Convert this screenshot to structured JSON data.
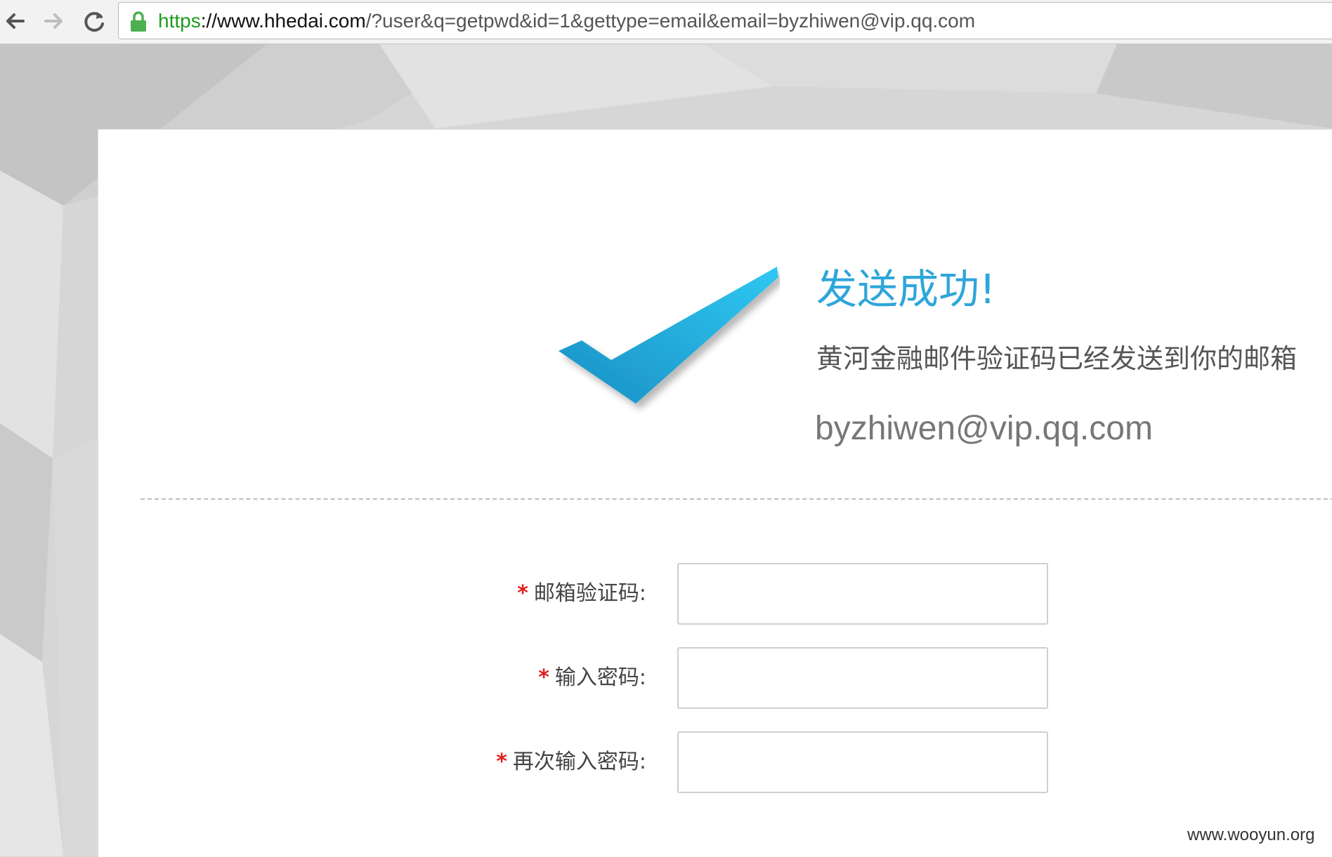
{
  "browser": {
    "url_scheme": "https",
    "url_host": "://www.hhedai.com",
    "url_rest": "/?user&q=getpwd&id=1&gettype=email&email=byzhiwen@vip.qq.com",
    "icons": {
      "back": "back-arrow-icon",
      "forward": "forward-arrow-icon",
      "reload": "reload-icon",
      "lock": "lock-icon"
    },
    "colors": {
      "secure": "#1e9c1e"
    }
  },
  "result": {
    "title": "发送成功!",
    "message": "黄河金融邮件验证码已经发送到你的邮箱",
    "email": "byzhiwen@vip.qq.com",
    "icon": "checkmark-icon",
    "accent_color": "#2ea6da"
  },
  "form": {
    "required_marker": "*",
    "fields": [
      {
        "label": "邮箱验证码:",
        "value": ""
      },
      {
        "label": "输入密码:",
        "value": ""
      },
      {
        "label": "再次输入密码:",
        "value": ""
      }
    ]
  },
  "watermark": "www.wooyun.org"
}
